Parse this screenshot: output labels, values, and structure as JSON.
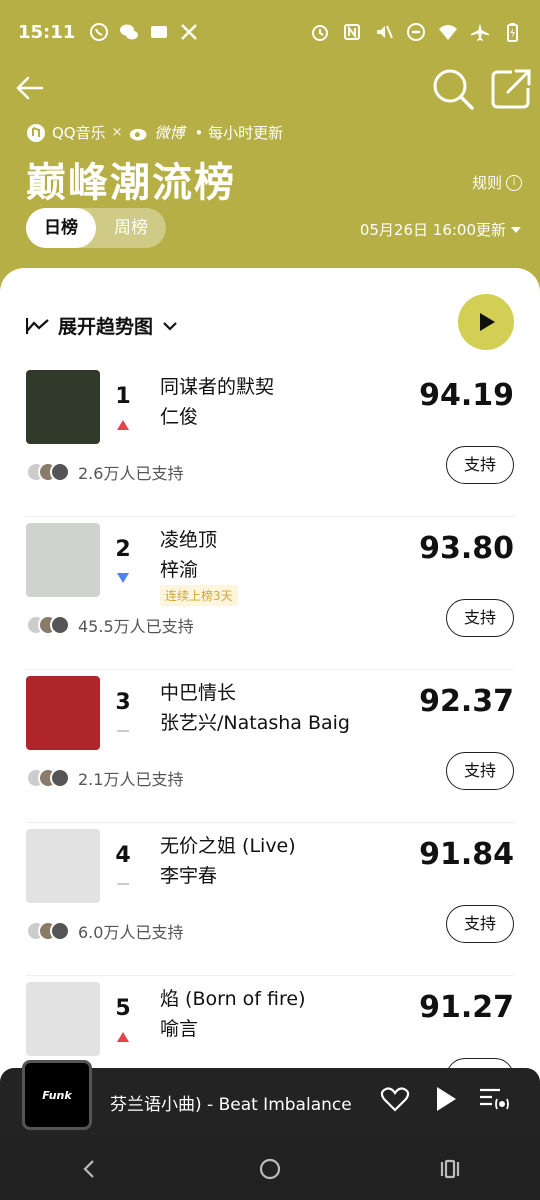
{
  "status_bar": {
    "time": "15:11",
    "left_icons": [
      "whatsapp-icon",
      "wechat-icon",
      "message-icon",
      "x-icon"
    ],
    "right_icons": [
      "alarm-icon",
      "nfc-icon",
      "mute-icon",
      "dnd-icon",
      "wifi-icon",
      "airplane-icon",
      "battery-icon"
    ]
  },
  "header": {
    "brand_qq": "QQ音乐",
    "brand_x": "×",
    "brand_weibo": "微博",
    "update_note": "• 每小时更新",
    "title": "巅峰潮流榜",
    "rules_label": "规则",
    "tabs": [
      {
        "label": "日榜",
        "active": true
      },
      {
        "label": "周榜",
        "active": false
      }
    ],
    "update_time": "05月26日 16:00更新"
  },
  "trend_toggle_label": "展开趋势图",
  "songs": [
    {
      "rank": "1",
      "title": "同谋者的默契",
      "artist": "仁俊",
      "score": "94.19",
      "trend": "up",
      "supporters": "2.6万人已支持",
      "badge": "",
      "cover_color": "#2f3a2b"
    },
    {
      "rank": "2",
      "title": "凌绝顶",
      "artist": "梓渝",
      "score": "93.80",
      "trend": "down",
      "supporters": "45.5万人已支持",
      "badge": "连续上榜3天",
      "cover_color": "#cfd3d0"
    },
    {
      "rank": "3",
      "title": "中巴情长",
      "artist": "张艺兴/Natasha Baig",
      "score": "92.37",
      "trend": "same",
      "supporters": "2.1万人已支持",
      "badge": "",
      "cover_color": "#b0262b"
    },
    {
      "rank": "4",
      "title": "无价之姐 (Live)",
      "artist": "李宇春",
      "score": "91.84",
      "trend": "same",
      "supporters": "6.0万人已支持",
      "badge": "",
      "cover_color": "#e2e2e2"
    },
    {
      "rank": "5",
      "title": "焰 (Born of fire)",
      "artist": "喻言",
      "score": "91.27",
      "trend": "up",
      "supporters": "",
      "badge": "",
      "cover_color": "#e2e2e2"
    }
  ],
  "support_label": "支持",
  "mini_player": {
    "title": "芬兰语小曲) - Beat Imbalance",
    "cover_text": "Funk"
  },
  "colors": {
    "brand_olive": "#b5af45",
    "play_button": "#d3cf54",
    "trend_up": "#e0454b",
    "trend_down": "#4a86e8"
  }
}
